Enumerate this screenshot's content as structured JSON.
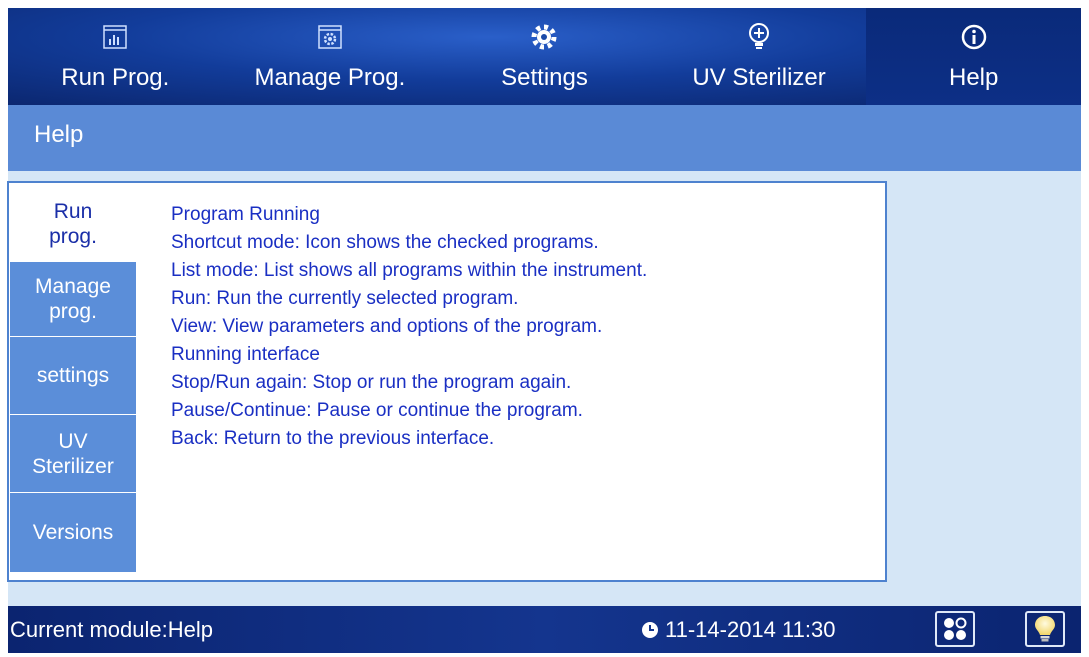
{
  "nav": {
    "items": [
      {
        "label": "Run Prog.",
        "icon": "chart-window-icon"
      },
      {
        "label": "Manage Prog.",
        "icon": "gear-window-icon"
      },
      {
        "label": "Settings",
        "icon": "gear-icon"
      },
      {
        "label": "UV Sterilizer",
        "icon": "bulb-plus-icon"
      },
      {
        "label": "Help",
        "icon": "info-circle-icon"
      }
    ],
    "active": "Help"
  },
  "title": "Help",
  "tabs": [
    {
      "label": "Run prog.",
      "active": true
    },
    {
      "label": "Manage prog.",
      "active": false
    },
    {
      "label": "settings",
      "active": false
    },
    {
      "label": "UV Sterilizer",
      "active": false
    },
    {
      "label": "Versions",
      "active": false
    }
  ],
  "help_lines": [
    "Program Running",
    "Shortcut mode: Icon shows the checked programs.",
    "List mode: List shows all programs within the instrument.",
    "Run: Run the currently selected program.",
    "View: View parameters and options of the program.",
    "Running interface",
    "Stop/Run again: Stop or run the program again.",
    "Pause/Continue: Pause or continue the program.",
    "Back: Return to the previous interface."
  ],
  "status": {
    "current_module": "Current module:Help",
    "datetime": "11-14-2014 11:30",
    "time_icon": "clock-icon",
    "grid_button_icon": "apps-grid-icon",
    "light_button_icon": "light-bulb-icon"
  },
  "colors": {
    "nav_bg": "#123c9a",
    "title_bar": "#5a8ad6",
    "tab_bg": "#5b8ed9",
    "content_bg": "#d5e6f6",
    "help_text": "#1a2fc3",
    "border": "#4e82cf"
  }
}
